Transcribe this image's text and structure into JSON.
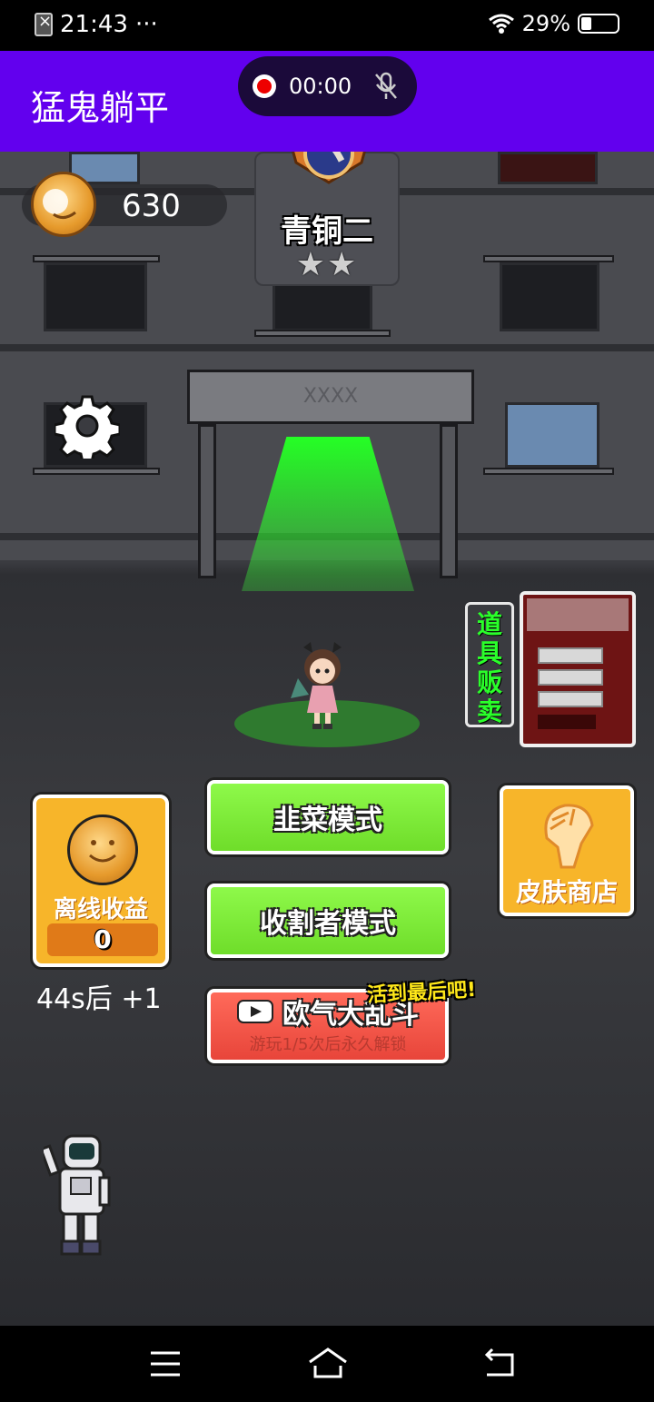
{
  "status_bar": {
    "time": "21:43",
    "dots": "···",
    "battery_percent": "29%",
    "battery_level": 0.29
  },
  "app_bar": {
    "title": "猛鬼躺平",
    "recording_time": "00:00"
  },
  "hud": {
    "coins": "630",
    "rank_name": "青铜二",
    "rank_stars": "★★"
  },
  "building": {
    "door_sign": "XXXX"
  },
  "shop": {
    "vending_label": "道具贩卖",
    "skin_shop_label": "皮肤商店"
  },
  "offline": {
    "title": "离线收益",
    "value": "0",
    "timer": "44s后 +1"
  },
  "modes": {
    "leek_mode": "韭菜模式",
    "reaper_mode": "收割者模式",
    "brawl_mode": "欧气大乱斗",
    "brawl_subtitle": "游玩1/5次后永久解锁",
    "brawl_tag": "活到最后吧!"
  },
  "icons": {
    "settings": "gear-icon",
    "coin": "coin-icon",
    "video": "video-icon",
    "skin": "peacock-icon",
    "nav_menu": "menu-icon",
    "nav_home": "home-icon",
    "nav_back": "back-icon"
  },
  "colors": {
    "app_bar": "#6200ee",
    "mode_green": "#8ef94a",
    "mode_red": "#ff6a5a",
    "card_orange": "#f7b52a",
    "beam_green": "#25ff25"
  }
}
